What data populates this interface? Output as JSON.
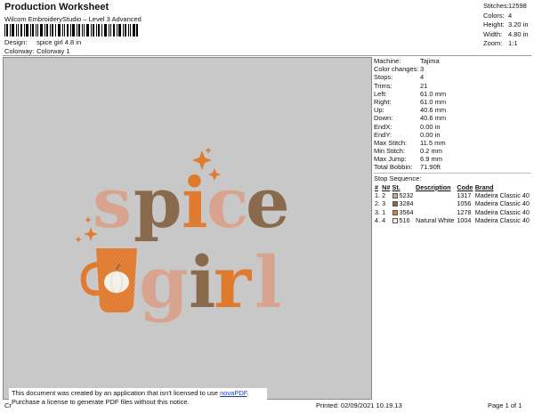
{
  "header": {
    "title": "Production Worksheet",
    "subtitle": "Wilcom EmbroideryStudio – Level 3 Advanced"
  },
  "design": {
    "label": "Design:",
    "value": "spice girl 4.8 in"
  },
  "colorway": {
    "label": "Colorway:",
    "value": "Colorway 1"
  },
  "top_stats": [
    {
      "label": "Stitches:",
      "value": "12598"
    },
    {
      "label": "Colors:",
      "value": "4"
    },
    {
      "label": "Height:",
      "value": "3.20 in"
    },
    {
      "label": "Width:",
      "value": "4.80 in"
    },
    {
      "label": "Zoom:",
      "value": "1:1"
    }
  ],
  "machine_stats": [
    {
      "label": "Machine:",
      "value": "Tajima"
    },
    {
      "label": "Color changes:",
      "value": "3"
    },
    {
      "label": "Stops:",
      "value": "4"
    },
    {
      "label": "Trims:",
      "value": "21"
    },
    {
      "label": "Left:",
      "value": "61.0 mm"
    },
    {
      "label": "Right:",
      "value": "61.0 mm"
    },
    {
      "label": "Up:",
      "value": "40.6 mm"
    },
    {
      "label": "Down:",
      "value": "40.6 mm"
    },
    {
      "label": "EndX:",
      "value": "0.00 in"
    },
    {
      "label": "EndY:",
      "value": "0.00 in"
    },
    {
      "label": "Max Stitch:",
      "value": "11.5 mm"
    },
    {
      "label": "Min Stitch:",
      "value": "0.2 mm"
    },
    {
      "label": "Max Jump:",
      "value": "6.9 mm"
    },
    {
      "label": "Total Bobbin:",
      "value": "71.90ft"
    }
  ],
  "stop_sequence": {
    "title": "Stop Sequence:",
    "headers": [
      "#",
      "N#",
      "St.",
      "Description",
      "Code",
      "Brand"
    ],
    "rows": [
      {
        "num": "1.",
        "n": "2",
        "color": "#d9a48f",
        "st": "5232",
        "desc": "",
        "code": "1317",
        "brand": "Madeira Classic 40"
      },
      {
        "num": "2.",
        "n": "3",
        "color": "#8a6a4d",
        "st": "3284",
        "desc": "",
        "code": "1056",
        "brand": "Madeira Classic 40"
      },
      {
        "num": "3.",
        "n": "1",
        "color": "#e07a2e",
        "st": "3564",
        "desc": "",
        "code": "1278",
        "brand": "Madeira Classic 40"
      },
      {
        "num": "4.",
        "n": "4",
        "color": "#f4f1ea",
        "st": "516",
        "desc": "Natural White",
        "code": "1004",
        "brand": "Madeira Classic 40"
      }
    ]
  },
  "notice": {
    "line1": "This document was created by an application that isn't licensed to use",
    "link": "novaPDF",
    "line2": "Purchase a license to generate PDF files without this notice."
  },
  "footer": {
    "left": "Cr",
    "printed": "Printed: 02/09/2021 10.19.13",
    "page": "Page 1 of 1"
  },
  "colors": {
    "pink": "#d9a48f",
    "brown": "#8a6a4d",
    "orange": "#e07a2e",
    "white": "#f4f1ea",
    "background": "#c8c8c8"
  }
}
